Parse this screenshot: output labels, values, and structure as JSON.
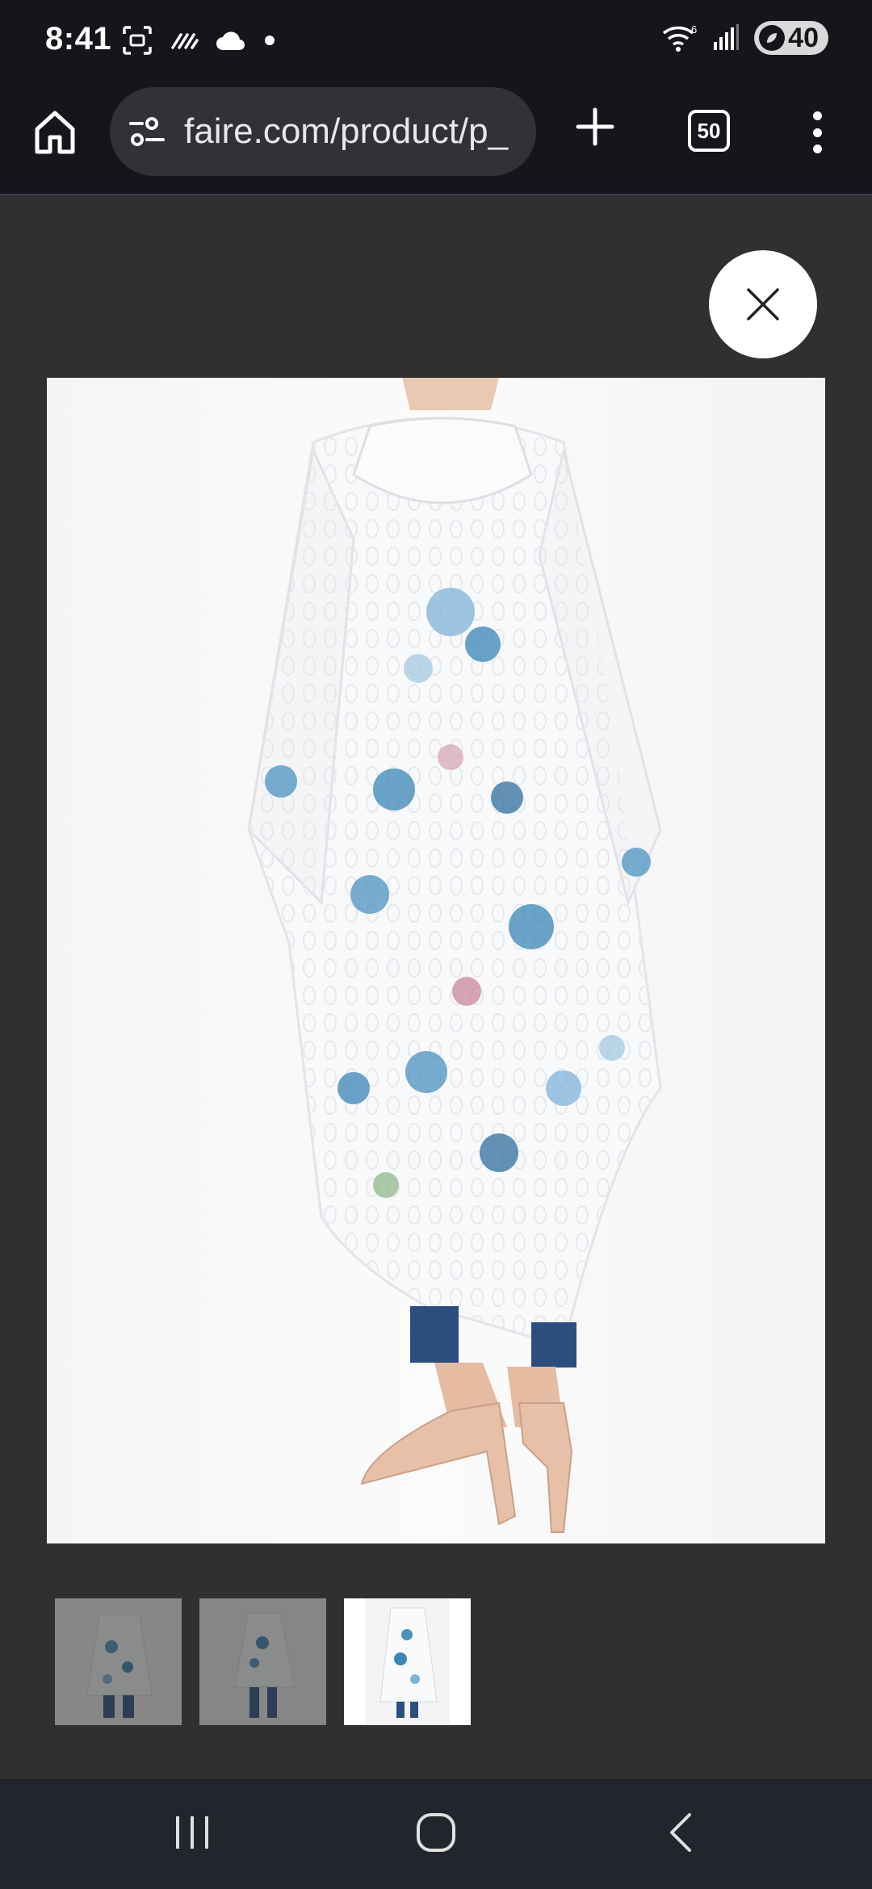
{
  "status_bar": {
    "time": "8:41",
    "battery": "40",
    "network": "6"
  },
  "browser": {
    "url": "faire.com/product/p_",
    "tab_count": "50"
  },
  "viewer": {
    "selected_thumbnail_index": 3,
    "thumbnail_count": 3
  },
  "colors": {
    "status_bg": "#14161b",
    "viewer_bg": "#303030",
    "nav_bg": "#22252c",
    "garment_blue": "#3a86b5"
  }
}
